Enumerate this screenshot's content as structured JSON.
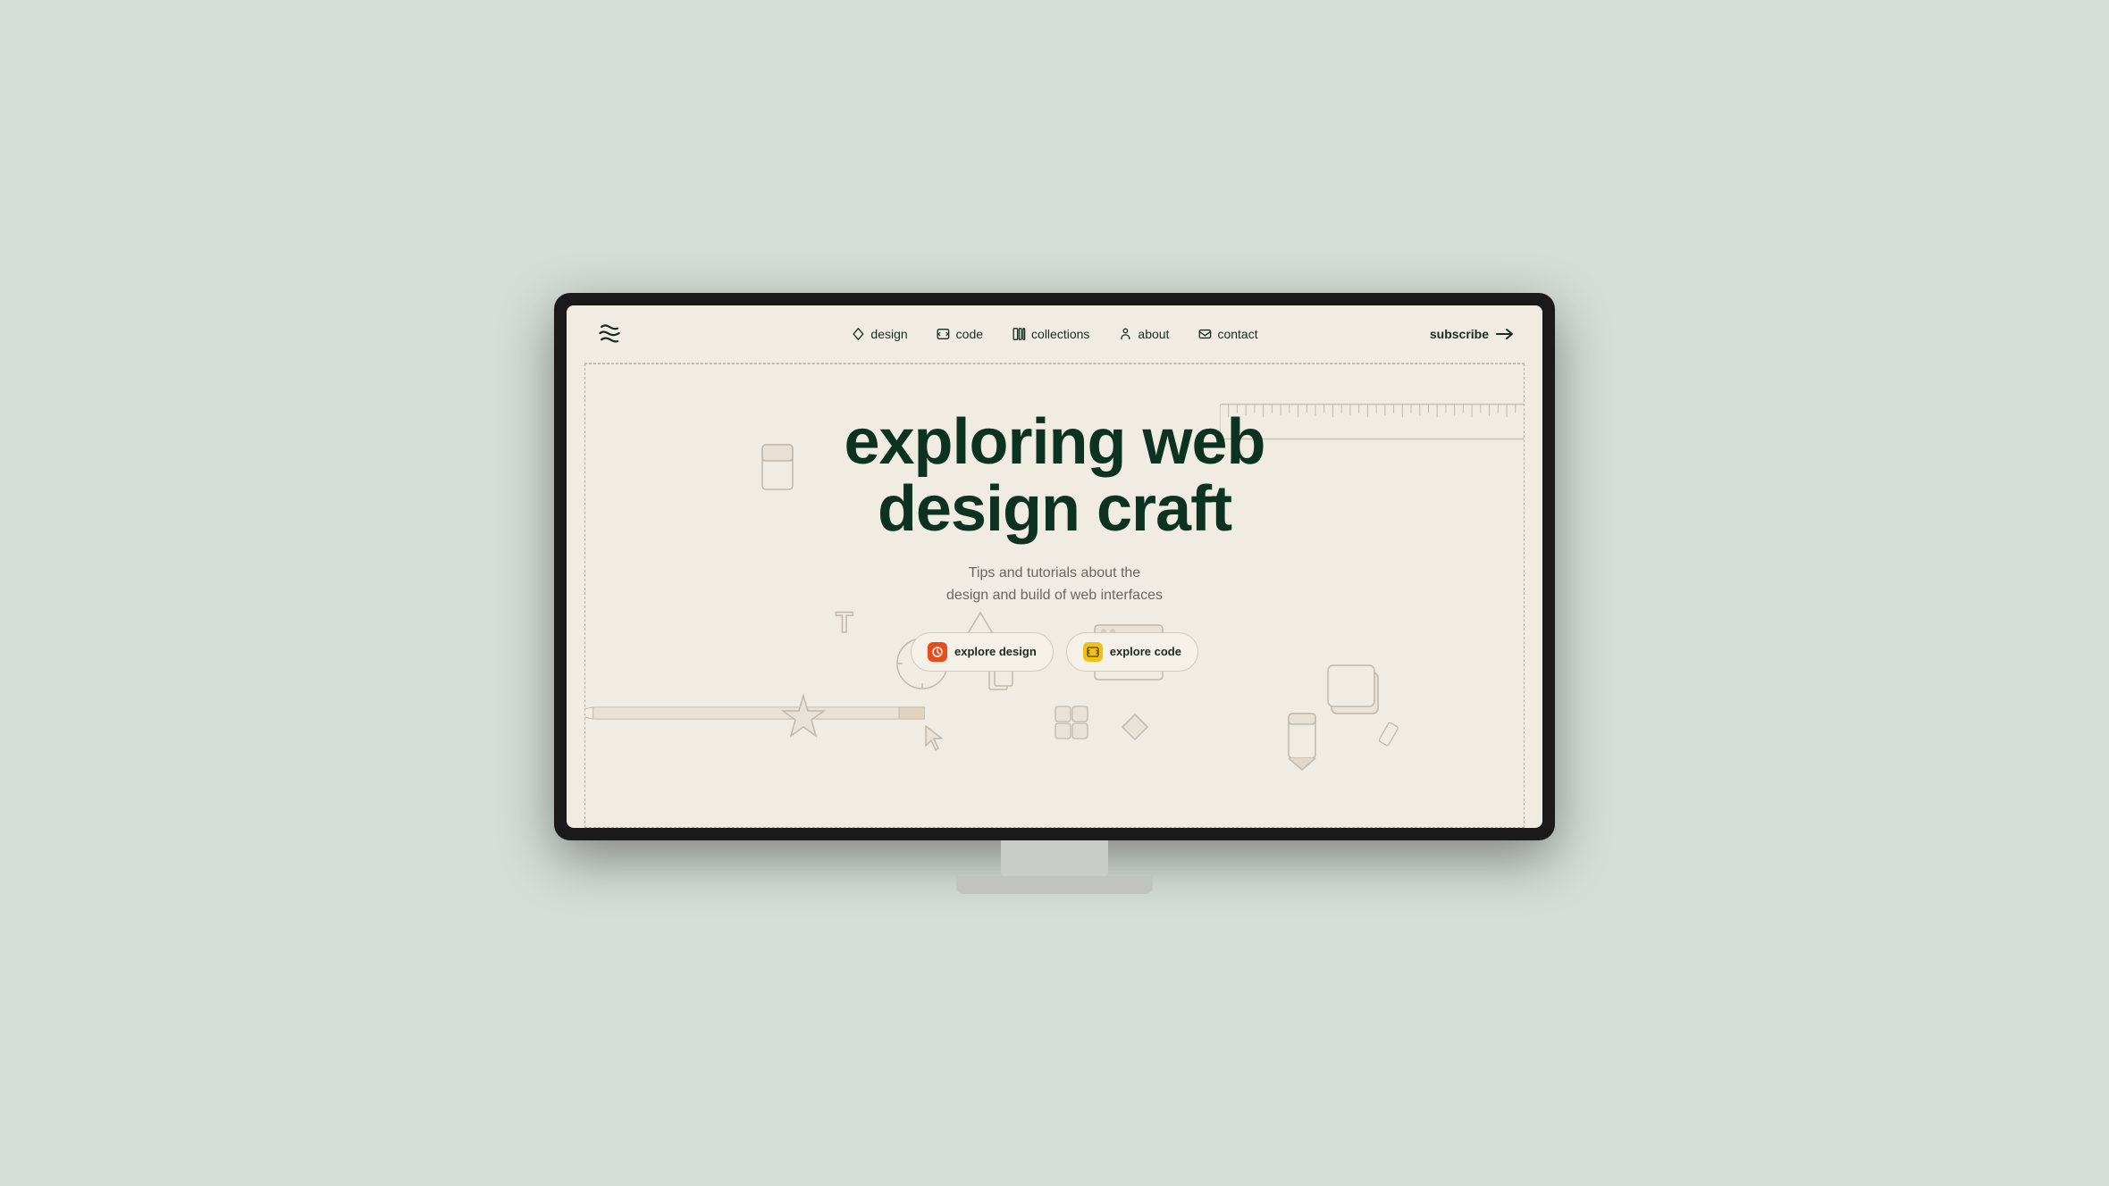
{
  "monitor": {
    "bg_color": "#d6ddd8",
    "screen_bg": "#f0ece4"
  },
  "nav": {
    "logo_alt": "logo",
    "links": [
      {
        "label": "design",
        "icon": "design-icon"
      },
      {
        "label": "code",
        "icon": "code-icon"
      },
      {
        "label": "collections",
        "icon": "collections-icon"
      },
      {
        "label": "about",
        "icon": "about-icon"
      },
      {
        "label": "contact",
        "icon": "contact-icon"
      }
    ],
    "subscribe_label": "subscribe"
  },
  "hero": {
    "title_line1": "exploring web",
    "title_line2": "design craft",
    "subtitle_line1": "Tips and tutorials about the",
    "subtitle_line2": "design and build of web interfaces",
    "btn_design": "explore design",
    "btn_code": "explore code"
  }
}
